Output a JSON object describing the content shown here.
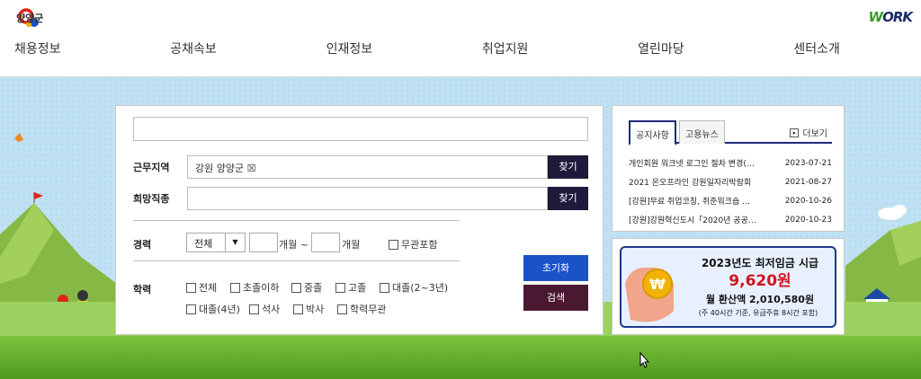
{
  "header": {
    "logo_text": "양양군",
    "brand_logo": "WORK",
    "nav": [
      "채용정보",
      "공채속보",
      "인재정보",
      "취업지원",
      "열린마당",
      "센터소개"
    ]
  },
  "search": {
    "keyword_value": "",
    "region_label": "근무지역",
    "region_value": "강원 양양군 ☒",
    "find_label": "찾기",
    "job_label": "희망직종",
    "job_value": "",
    "career_label": "경력",
    "career_select": "전체",
    "months_from": "개월 ~",
    "months_to": "개월",
    "career_any": "무관포함",
    "edu_label": "학력",
    "edu_options_row1": [
      "전체",
      "초졸이하",
      "중졸",
      "고졸",
      "대졸(2~3년)"
    ],
    "edu_options_row2": [
      "대졸(4년)",
      "석사",
      "박사",
      "학력무관"
    ],
    "reset_label": "초기화",
    "search_label": "검색"
  },
  "notice": {
    "tab_active": "공지사항",
    "tab_other": "고용뉴스",
    "more": "더보기",
    "items": [
      {
        "title": "개인회원 워크넷 로그인 절차 변경(…",
        "date": "2023-07-21"
      },
      {
        "title": "2021 온오프라인 강원일자리박람회",
        "date": "2021-08-27"
      },
      {
        "title": "[강원]무료 취업코칭, 취준워크숍 …",
        "date": "2020-10-26"
      },
      {
        "title": "[강원]강원혁신도시「2020년 공공…",
        "date": "2020-10-23"
      }
    ]
  },
  "banner": {
    "line1": "2023년도 최저임금 시급",
    "line2": "9,620원",
    "line3": "월 환산액 2,010,580원",
    "line4": "(주 40시간 기준, 유급주휴 8시간 포함)",
    "coin_symbol": "₩"
  },
  "colors": {
    "find_button": "#1e1b3a",
    "reset_button": "#1a52c8",
    "search_button": "#4a1830",
    "tab_border": "#1e2a7a",
    "wage_red": "#d0141e"
  },
  "icons": [
    "yangyang-logo-icon",
    "worknet-logo-icon",
    "mouse-cursor-icon",
    "checkbox-icon",
    "more-plus-icon"
  ]
}
